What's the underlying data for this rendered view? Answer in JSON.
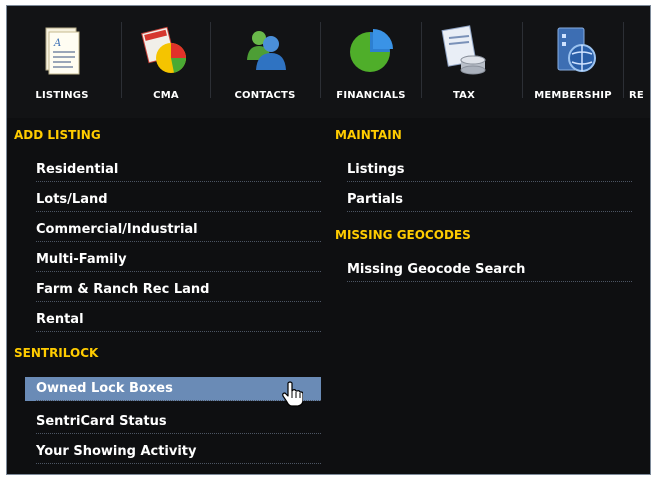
{
  "toolbar": {
    "items": [
      {
        "label": "LISTINGS",
        "icon": "listings-icon"
      },
      {
        "label": "CMA",
        "icon": "cma-icon"
      },
      {
        "label": "CONTACTS",
        "icon": "contacts-icon"
      },
      {
        "label": "FINANCIALS",
        "icon": "financials-icon"
      },
      {
        "label": "TAX",
        "icon": "tax-icon"
      },
      {
        "label": "MEMBERSHIP",
        "icon": "membership-icon"
      },
      {
        "label": "RE",
        "icon": ""
      }
    ]
  },
  "left": {
    "add_listing": {
      "title": "ADD LISTING",
      "items": [
        "Residential",
        "Lots/Land",
        "Commercial/Industrial",
        "Multi-Family",
        "Farm & Ranch Rec Land",
        "Rental"
      ]
    },
    "sentrilock": {
      "title": "SENTRILOCK",
      "items": [
        "Owned Lock Boxes",
        "SentriCard Status",
        "Your Showing Activity"
      ],
      "highlighted": "Owned Lock Boxes"
    }
  },
  "right": {
    "maintain": {
      "title": "MAINTAIN",
      "items": [
        "Listings",
        "Partials"
      ]
    },
    "missing_geocodes": {
      "title": "MISSING GEOCODES",
      "items": [
        "Missing Geocode Search"
      ]
    }
  },
  "colors": {
    "background": "#0e0f11",
    "section_heading": "#ffcc00",
    "highlight": "#6a8bb6",
    "text": "#ffffff"
  }
}
